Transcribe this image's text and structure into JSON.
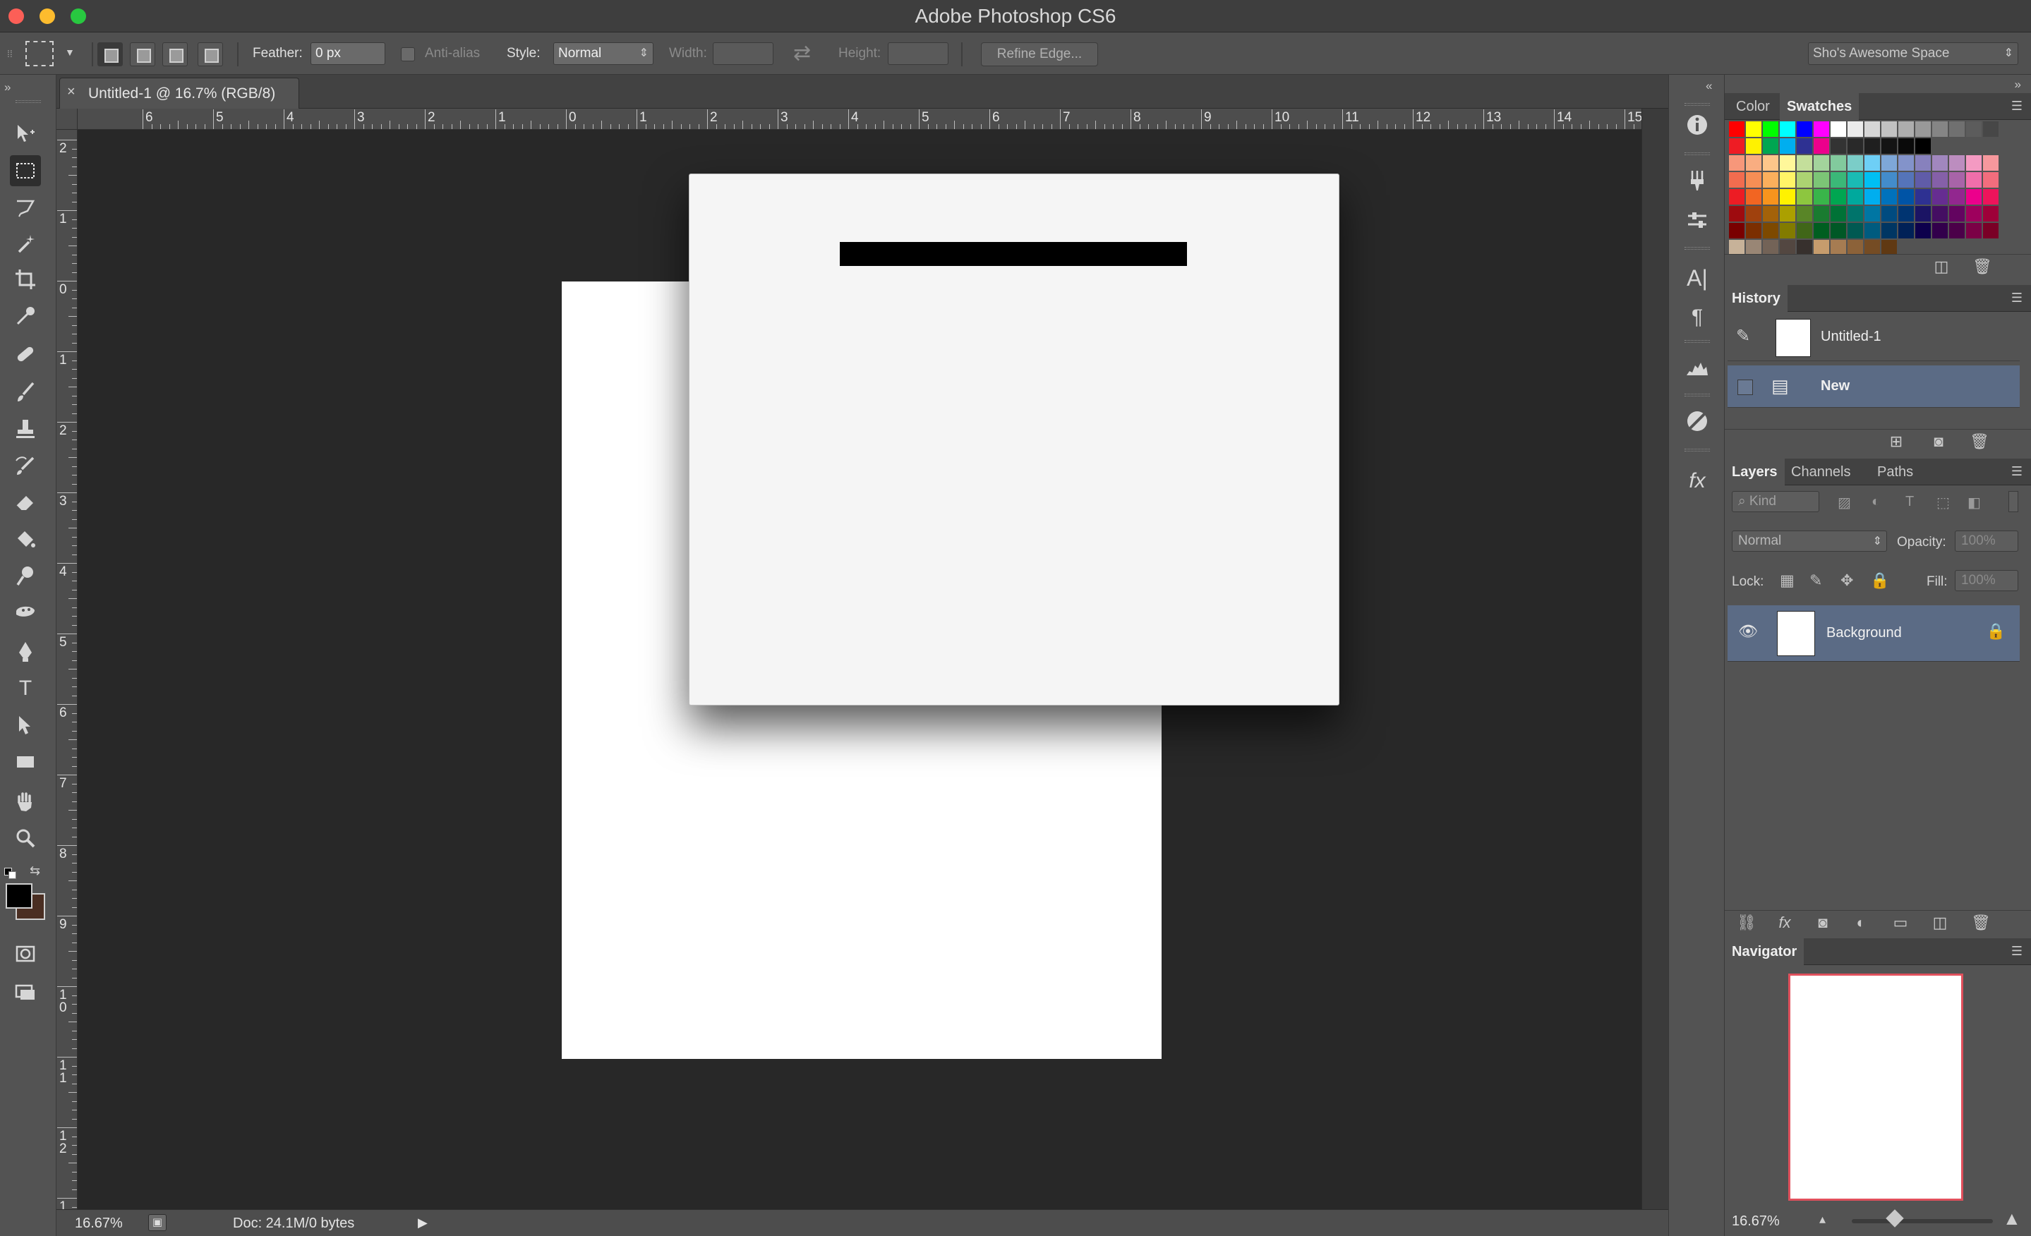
{
  "app": {
    "title": "Adobe Photoshop CS6"
  },
  "options_bar": {
    "feather_label": "Feather:",
    "feather_value": "0 px",
    "antialias_label": "Anti-alias",
    "style_label": "Style:",
    "style_value": "Normal",
    "width_label": "Width:",
    "height_label": "Height:",
    "refine_edge_label": "Refine Edge...",
    "workspace_value": "Sho's Awesome Space"
  },
  "document": {
    "tab_label": "Untitled-1 @ 16.7% (RGB/8)",
    "close_glyph": "×"
  },
  "rulers": {
    "top_labels": [
      "6",
      "5",
      "4",
      "3",
      "2",
      "1",
      "0",
      "1",
      "2",
      "3",
      "4",
      "5",
      "6",
      "7",
      "8",
      "9",
      "10",
      "11",
      "12",
      "13",
      "14",
      "15"
    ],
    "left_labels": [
      "2",
      "1",
      "0",
      "1",
      "2",
      "3",
      "4",
      "5",
      "6",
      "7",
      "8",
      "9",
      "1 0",
      "1 1",
      "1 2",
      "1"
    ]
  },
  "status": {
    "zoom": "16.67%",
    "doc_info": "Doc: 24.1M/0 bytes",
    "arrow": "▶"
  },
  "toolbar": {
    "tools": [
      "move-tool",
      "marquee-tool",
      "lasso-tool",
      "magic-wand-tool",
      "crop-tool",
      "eyedropper-tool",
      "healing-brush-tool",
      "brush-tool",
      "clone-stamp-tool",
      "history-brush-tool",
      "eraser-tool",
      "paint-bucket-tool",
      "dodge-tool",
      "sponge-tool",
      "pen-tool",
      "type-tool",
      "path-selection-tool",
      "rectangle-tool",
      "hand-tool",
      "zoom-tool"
    ],
    "foreground_color": "#000000",
    "background_color": "#4a2e22"
  },
  "panels": {
    "color_tab": "Color",
    "swatches_tab": "Swatches",
    "history_title": "History",
    "history_items": [
      {
        "label": "Untitled-1"
      },
      {
        "label": "New"
      }
    ],
    "layers_tab": "Layers",
    "channels_tab": "Channels",
    "paths_tab": "Paths",
    "kind_label": "Kind",
    "blend_mode": "Normal",
    "opacity_label": "Opacity:",
    "opacity_value": "100%",
    "lock_label": "Lock:",
    "fill_label": "Fill:",
    "fill_value": "100%",
    "layer_name": "Background",
    "navigator_title": "Navigator",
    "navigator_zoom": "16.67%",
    "menu_glyph": "☰"
  },
  "swatch_colors": [
    [
      "#ff0000",
      "#ffff00",
      "#00ff00",
      "#00ffff",
      "#0000ff",
      "#ff00ff",
      "#ffffff",
      "#ebebeb",
      "#d6d6d6",
      "#c2c2c2",
      "#adadad",
      "#999999",
      "#858585",
      "#707070",
      "#5c5c5c",
      "#474747"
    ],
    [
      "#ee1c24",
      "#fff200",
      "#00a651",
      "#00aeef",
      "#2e3192",
      "#ec008c",
      "#333333",
      "#292929",
      "#1f1f1f",
      "#141414",
      "#0a0a0a",
      "#000000"
    ],
    [
      "#f7977a",
      "#f9ad81",
      "#fdc68a",
      "#fff79a",
      "#c4df9b",
      "#a3d39c",
      "#82ca9d",
      "#7bcdc8",
      "#6ecff6",
      "#7ea7d8",
      "#8393ca",
      "#8781bd",
      "#a187be",
      "#bc8dbf",
      "#f49ac2",
      "#f6989d"
    ],
    [
      "#f26c4f",
      "#f68e55",
      "#fbaf5c",
      "#fff467",
      "#acd372",
      "#7cc576",
      "#3bb878",
      "#1abbb4",
      "#00bff3",
      "#438ccb",
      "#5574b9",
      "#605ca8",
      "#8560a8",
      "#a864a8",
      "#f06eaa",
      "#f26d7d"
    ],
    [
      "#ed1c24",
      "#f26522",
      "#f7941d",
      "#fff200",
      "#8dc63f",
      "#39b54a",
      "#00a651",
      "#00a99d",
      "#00aeef",
      "#0072bc",
      "#0054a6",
      "#2e3192",
      "#662d91",
      "#92278f",
      "#ec008c",
      "#ed145b"
    ],
    [
      "#9e0b0f",
      "#a0410d",
      "#a36209",
      "#aba000",
      "#598527",
      "#1a7b30",
      "#007236",
      "#00746b",
      "#0076a3",
      "#004b80",
      "#003471",
      "#1b1464",
      "#440e62",
      "#630460",
      "#9e005d",
      "#9e0039"
    ],
    [
      "#790000",
      "#7b2e00",
      "#7d4900",
      "#827b00",
      "#406618",
      "#005e20",
      "#005826",
      "#005952",
      "#005b7f",
      "#003663",
      "#002157",
      "#0d004c",
      "#32004b",
      "#4b0049",
      "#7b0046",
      "#7a0026"
    ],
    [
      "#c7b299",
      "#998675",
      "#736357",
      "#534741",
      "#37302d",
      "#c69c6d",
      "#a67c52",
      "#8c6239",
      "#754c24",
      "#603913"
    ]
  ]
}
